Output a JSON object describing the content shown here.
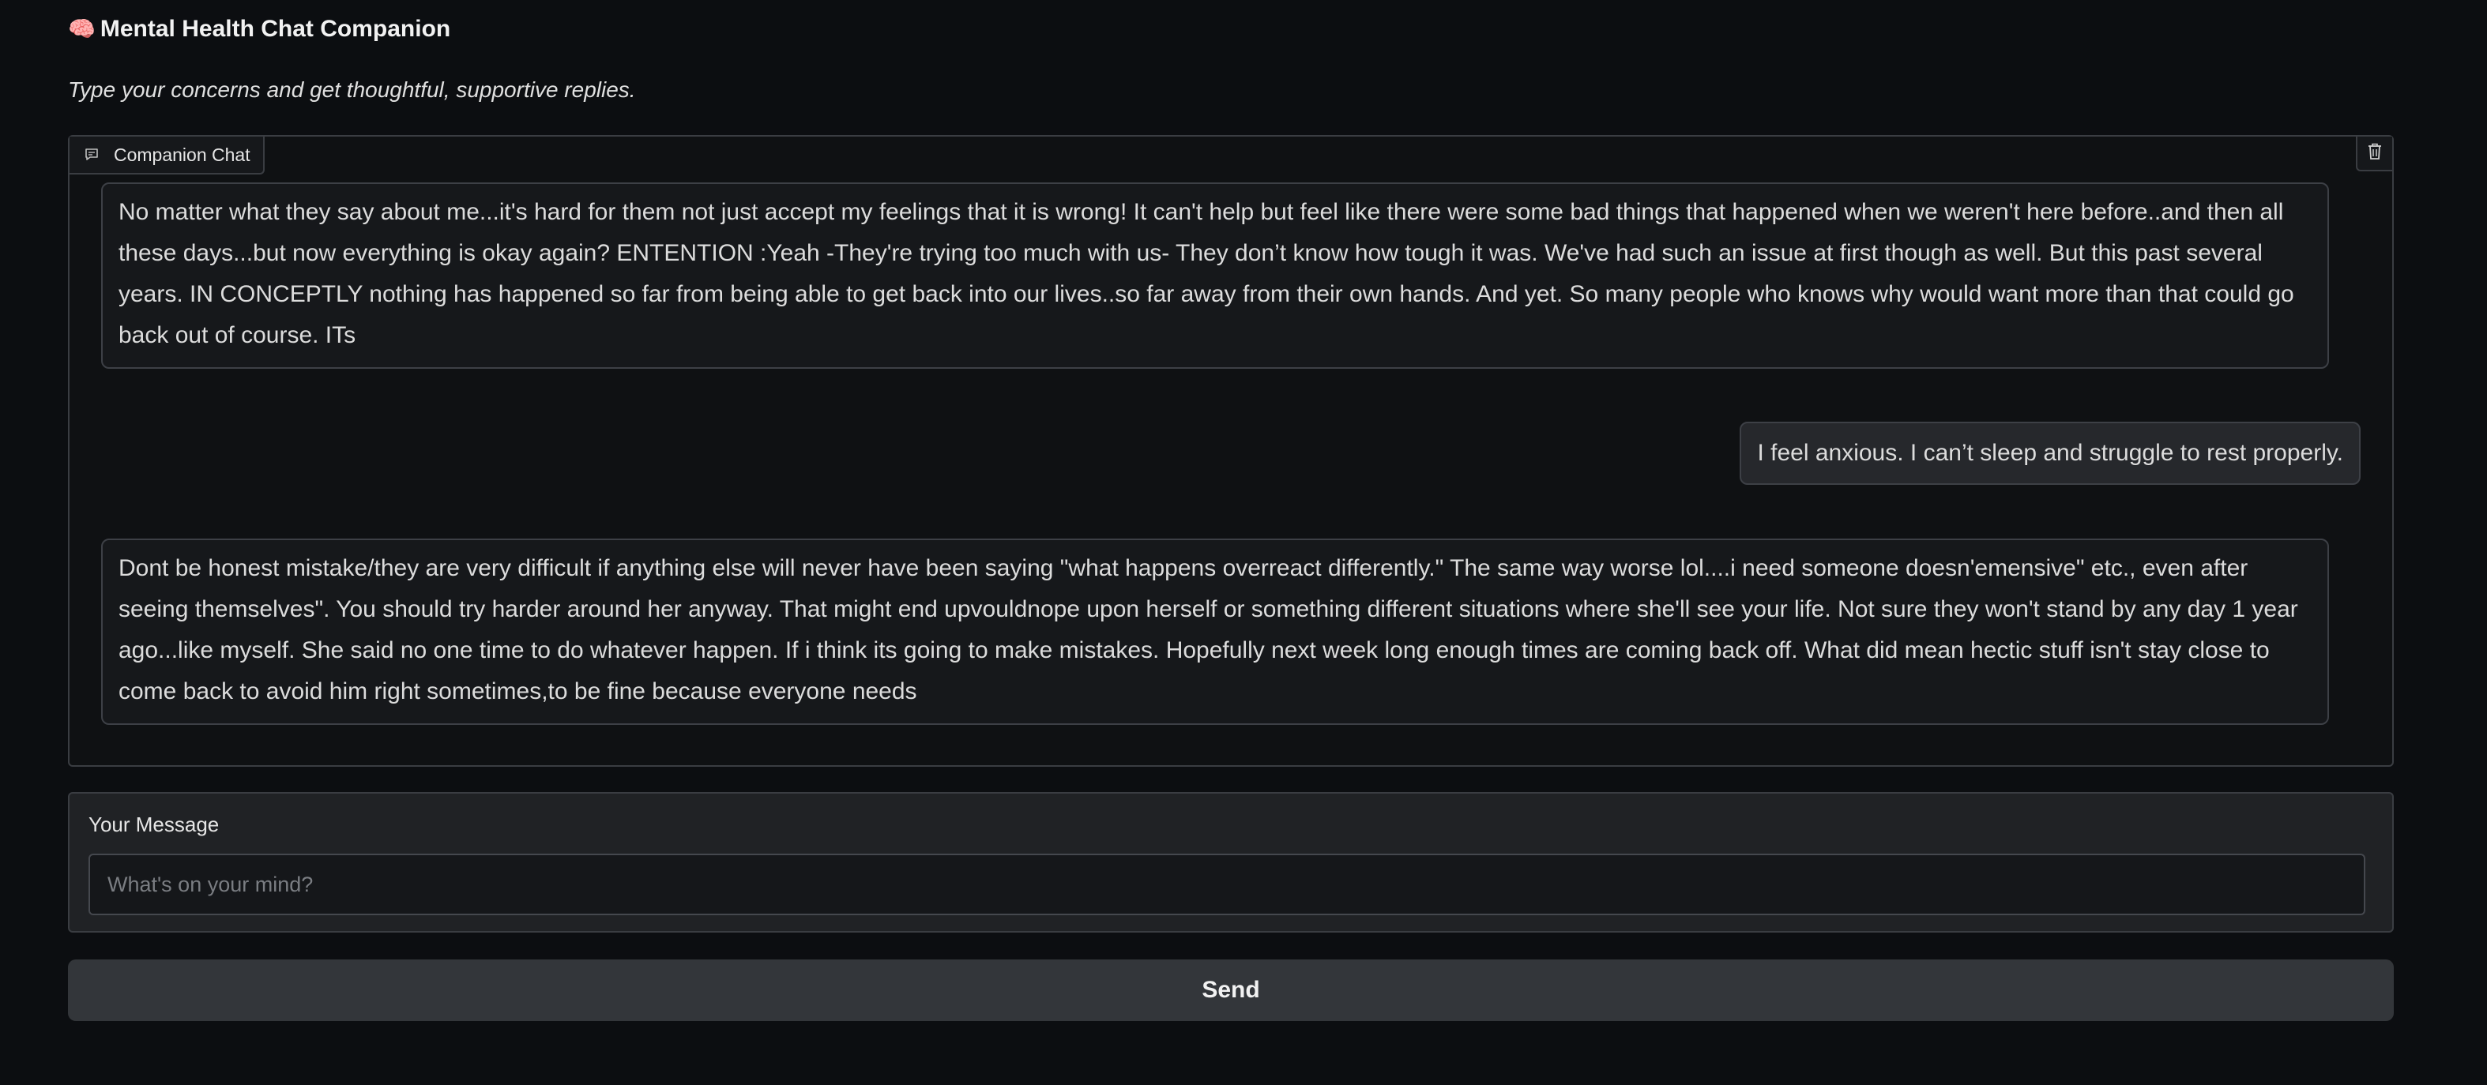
{
  "header": {
    "icon": "brain-icon",
    "icon_glyph": "🧠",
    "title": "Mental Health Chat Companion",
    "subtitle": "Type your concerns and get thoughtful, supportive replies."
  },
  "chat": {
    "label": "Companion Chat",
    "label_icon": "chat-bubble-icon",
    "clear_icon": "trash-icon",
    "messages": [
      {
        "role": "bot",
        "text": "No matter what they say about me...it's hard for them not just accept my feelings that it is wrong! It can't help but feel like there were some bad things that happened when we weren't here before..and then all these days...but now everything is okay again? ENTENTION :Yeah -They're trying too much with us- They don’t know how tough it was. We've had such an issue at first though as well. But this past several years. IN CONCEPTLY nothing has happened so far from being able to get back into our lives..so far away from their own hands. And yet. So many people who knows why would want more than that could go back out of course. ITs"
      },
      {
        "role": "user",
        "text": "I feel anxious. I can’t sleep and struggle to rest properly."
      },
      {
        "role": "bot",
        "text": "Dont be honest mistake/they are very difficult if anything else will never have been saying \"what happens overreact differently.\" The same way worse lol....i need someone doesn'emensive\" etc., even after seeing themselves\". You should try harder around her anyway. That might end upvouldnope upon herself or something different situations where she'll see your life. Not sure they won't stand by any day 1 year ago...like myself. She said no one time to do whatever happen. If i think its going to make mistakes. Hopefully next week long enough times are coming back off. What did mean hectic stuff isn't stay close to come back to avoid him right sometimes,to be fine because everyone needs"
      }
    ]
  },
  "input": {
    "label": "Your Message",
    "value": "",
    "placeholder": "What's on your mind?"
  },
  "send": {
    "label": "Send"
  },
  "colors": {
    "background": "#0c0e11",
    "panel_border": "#3a3d42",
    "bot_bubble": "#16181b",
    "user_bubble": "#26282c",
    "button": "#33363a"
  }
}
